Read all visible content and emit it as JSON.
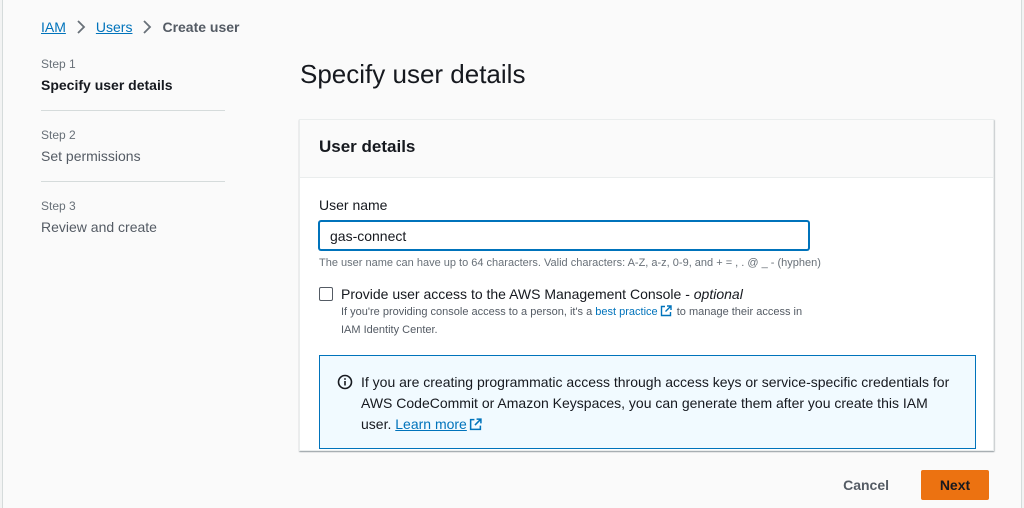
{
  "breadcrumb": {
    "items": [
      "IAM",
      "Users"
    ],
    "current": "Create user"
  },
  "steps": [
    {
      "number": "Step 1",
      "label": "Specify user details",
      "active": true
    },
    {
      "number": "Step 2",
      "label": "Set permissions",
      "active": false
    },
    {
      "number": "Step 3",
      "label": "Review and create",
      "active": false
    }
  ],
  "page_title": "Specify user details",
  "panel": {
    "title": "User details",
    "username_label": "User name",
    "username_value": "gas-connect",
    "username_hint": "The user name can have up to 64 characters. Valid characters: A-Z, a-z, 0-9, and + = , . @ _ - (hyphen)",
    "console_access": {
      "checked": false,
      "label": "Provide user access to the AWS Management Console - ",
      "label_optional": "optional",
      "desc_prefix": "If you're providing console access to a person, it's a ",
      "desc_link": "best practice",
      "desc_suffix": " to manage their access in IAM Identity Center."
    },
    "info_alert": {
      "text": "If you are creating programmatic access through access keys or service-specific credentials for AWS CodeCommit or Amazon Keyspaces, you can generate them after you create this IAM user. ",
      "link": "Learn more"
    }
  },
  "actions": {
    "cancel_label": "Cancel",
    "next_label": "Next"
  },
  "colors": {
    "link": "#0073bb",
    "primary_button": "#ec7211",
    "info_background": "#f1faff"
  },
  "icons": [
    "chevron-right-icon",
    "external-link-icon",
    "info-icon"
  ]
}
